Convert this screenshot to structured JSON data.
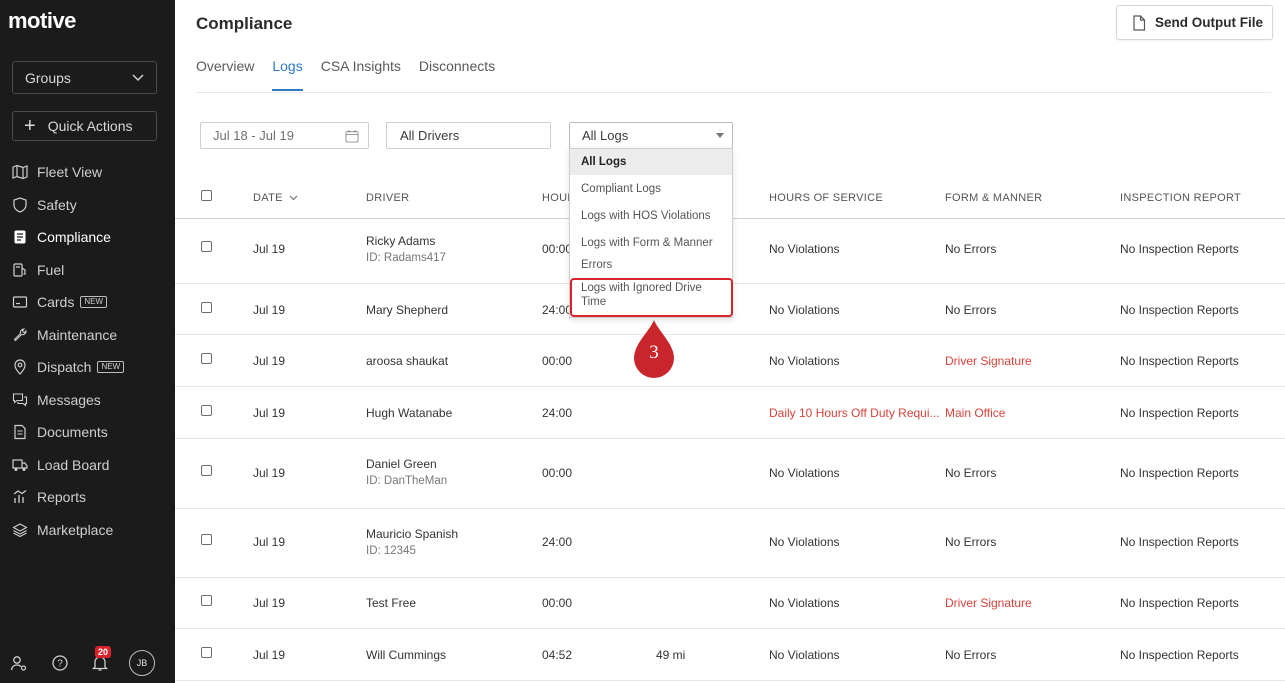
{
  "sidebar": {
    "logo": "motive",
    "groups_label": "Groups",
    "quick_actions_label": "Quick Actions",
    "items": [
      {
        "label": "Fleet View",
        "icon": "map-icon"
      },
      {
        "label": "Safety",
        "icon": "shield-icon"
      },
      {
        "label": "Compliance",
        "icon": "document-icon"
      },
      {
        "label": "Fuel",
        "icon": "fuel-icon"
      },
      {
        "label": "Cards",
        "icon": "card-icon",
        "badge": "NEW"
      },
      {
        "label": "Maintenance",
        "icon": "wrench-icon"
      },
      {
        "label": "Dispatch",
        "icon": "location-pin-icon",
        "badge": "NEW"
      },
      {
        "label": "Messages",
        "icon": "messages-icon"
      },
      {
        "label": "Documents",
        "icon": "documents-icon"
      },
      {
        "label": "Load Board",
        "icon": "truck-icon"
      },
      {
        "label": "Reports",
        "icon": "reports-icon"
      },
      {
        "label": "Marketplace",
        "icon": "layers-icon"
      }
    ],
    "notification_count": "20",
    "avatar_initials": "JB"
  },
  "header": {
    "title": "Compliance",
    "send_button_label": "Send Output File"
  },
  "tabs": [
    "Overview",
    "Logs",
    "CSA Insights",
    "Disconnects"
  ],
  "filters": {
    "date_range": "Jul 18 - Jul 19",
    "drivers": "All Drivers",
    "logs": "All Logs"
  },
  "dropdown": {
    "options": [
      "All Logs",
      "Compliant Logs",
      "Logs with HOS Violations",
      "Logs with Form & Manner",
      "Errors",
      "Logs with Ignored Drive",
      "Time"
    ],
    "step_number": "3"
  },
  "table": {
    "headers": {
      "date": "DATE",
      "driver": "DRIVER",
      "hours": "HOUR",
      "hos": "HOURS OF SERVICE",
      "form": "FORM & MANNER",
      "inspection": "INSPECTION REPORT"
    },
    "rows": [
      {
        "date": "Jul 19",
        "driver": "Ricky Adams",
        "driver_id": "ID: Radams417",
        "hours": "00:00",
        "distance": "",
        "hos": "No Violations",
        "form": "No Errors",
        "inspection": "No Inspection Reports"
      },
      {
        "date": "Jul 19",
        "driver": "Mary Shepherd",
        "driver_id": "",
        "hours": "24:00",
        "distance": "",
        "hos": "No Violations",
        "form": "No Errors",
        "inspection": "No Inspection Reports"
      },
      {
        "date": "Jul 19",
        "driver": "aroosa shaukat",
        "driver_id": "",
        "hours": "00:00",
        "distance": "",
        "hos": "No Violations",
        "form": "Driver Signature",
        "inspection": "No Inspection Reports"
      },
      {
        "date": "Jul 19",
        "driver": "Hugh Watanabe",
        "driver_id": "",
        "hours": "24:00",
        "distance": "",
        "hos": "Daily 10 Hours Off Duty Requi...",
        "form": "Main Office",
        "inspection": "No Inspection Reports"
      },
      {
        "date": "Jul 19",
        "driver": "Daniel Green",
        "driver_id": "ID: DanTheMan",
        "hours": "00:00",
        "distance": "",
        "hos": "No Violations",
        "form": "No Errors",
        "inspection": "No Inspection Reports"
      },
      {
        "date": "Jul 19",
        "driver": "Mauricio Spanish",
        "driver_id": "ID: 12345",
        "hours": "24:00",
        "distance": "",
        "hos": "No Violations",
        "form": "No Errors",
        "inspection": "No Inspection Reports"
      },
      {
        "date": "Jul 19",
        "driver": "Test Free",
        "driver_id": "",
        "hours": "00:00",
        "distance": "",
        "hos": "No Violations",
        "form": "Driver Signature",
        "inspection": "No Inspection Reports"
      },
      {
        "date": "Jul 19",
        "driver": "Will Cummings",
        "driver_id": "",
        "hours": "04:52",
        "distance": "49 mi",
        "hos": "No Violations",
        "form": "No Errors",
        "inspection": "No Inspection Reports"
      }
    ]
  },
  "colors": {
    "sidebar_bg": "#1b1b1b",
    "accent": "#2f7bc2",
    "error": "#d8433a",
    "highlight": "#d8232a"
  }
}
